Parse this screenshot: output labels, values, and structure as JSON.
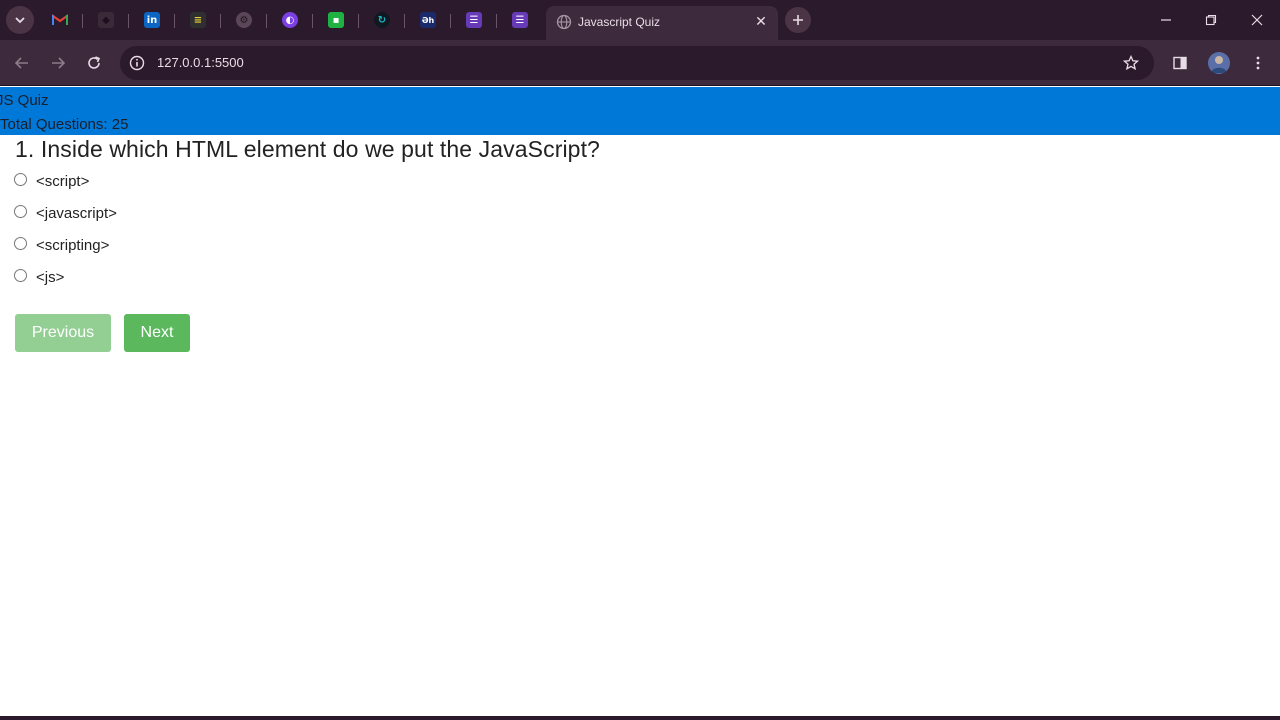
{
  "browser": {
    "tab_title": "Javascript Quiz",
    "address": "127.0.0.1:5500",
    "pinned_tabs": [
      {
        "icon": "gmail-icon",
        "color": "#ea4335"
      },
      {
        "icon": "github-icon",
        "color": "#3a2a38"
      },
      {
        "icon": "linkedin-icon",
        "color": "#0a66c2"
      },
      {
        "icon": "notes-app-icon",
        "color": "#2f2f2f"
      },
      {
        "icon": "chatgpt-icon",
        "color": "#5a4656"
      },
      {
        "icon": "app-icon",
        "color": "#7b3fe4"
      },
      {
        "icon": "chat-icon",
        "color": "#1fb141"
      },
      {
        "icon": "app-icon",
        "color": "#20b8c8"
      },
      {
        "icon": "app-icon",
        "color": "#1b2a6b"
      },
      {
        "icon": "forms-icon",
        "color": "#673ab7"
      },
      {
        "icon": "forms-icon",
        "color": "#673ab7"
      }
    ]
  },
  "header": {
    "brand": "JS Quiz",
    "total": "Total Questions: 25",
    "color": "#0078d7"
  },
  "quiz": {
    "question": "1. Inside which HTML element do we put the JavaScript?",
    "options": [
      "<script>",
      "<javascript>",
      "<scripting>",
      "<js>"
    ],
    "previous_label": "Previous",
    "next_label": "Next",
    "button_color": "#5cb85c"
  }
}
